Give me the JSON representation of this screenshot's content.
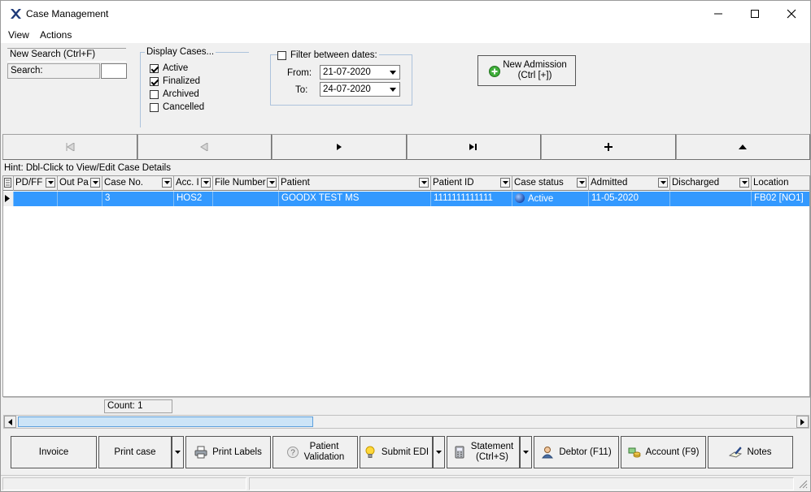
{
  "window": {
    "title": "Case Management",
    "icon": "goodx-x-icon"
  },
  "menu": [
    {
      "label": "View"
    },
    {
      "label": "Actions"
    }
  ],
  "search": {
    "new_search_label": "New Search (Ctrl+F)",
    "search_label": "Search:",
    "search_value": ""
  },
  "display_cases": {
    "title": "Display Cases...",
    "options": [
      {
        "label": "Active",
        "checked": true
      },
      {
        "label": "Finalized",
        "checked": true
      },
      {
        "label": "Archived",
        "checked": false
      },
      {
        "label": "Cancelled",
        "checked": false
      }
    ]
  },
  "date_filter": {
    "title": "Filter between dates:",
    "checked": false,
    "from_label": "From:",
    "from_value": "21-07-2020",
    "to_label": "To:",
    "to_value": "24-07-2020"
  },
  "new_admission": {
    "line1": "New Admission",
    "line2": "(Ctrl [+])"
  },
  "navigator": [
    "first",
    "prior",
    "next",
    "last",
    "insert",
    "scroll-up"
  ],
  "hint": "Hint: Dbl-Click to View/Edit Case Details",
  "grid": {
    "columns": [
      "PD/FF",
      "Out Pa",
      "Case No.",
      "Acc. I",
      "File Number",
      "Patient",
      "Patient ID",
      "Case status",
      "Admitted",
      "Discharged",
      "Location"
    ],
    "rows": [
      {
        "pdff": "",
        "outpa": "",
        "case_no": "3",
        "acc": "HOS2",
        "file_number": "",
        "patient": "GOODX TEST MS",
        "patient_id": "1111111111111",
        "status": "Active",
        "admitted": "11-05-2020",
        "discharged": "",
        "location": "FB02 [NO1]"
      }
    ]
  },
  "count": "Count: 1",
  "hscroll_position": 0,
  "buttons": {
    "invoice": "Invoice",
    "print_case": "Print case",
    "print_labels": "Print Labels",
    "patient_validation_1": "Patient",
    "patient_validation_2": "Validation",
    "submit_edi": "Submit EDI",
    "statement_1": "Statement",
    "statement_2": "(Ctrl+S)",
    "debtor": "Debtor (F11)",
    "account": "Account (F9)",
    "notes": "Notes"
  },
  "colors": {
    "selection": "#3399ff",
    "window_bg": "#f0f0f0",
    "group_border": "#adc3dc"
  }
}
